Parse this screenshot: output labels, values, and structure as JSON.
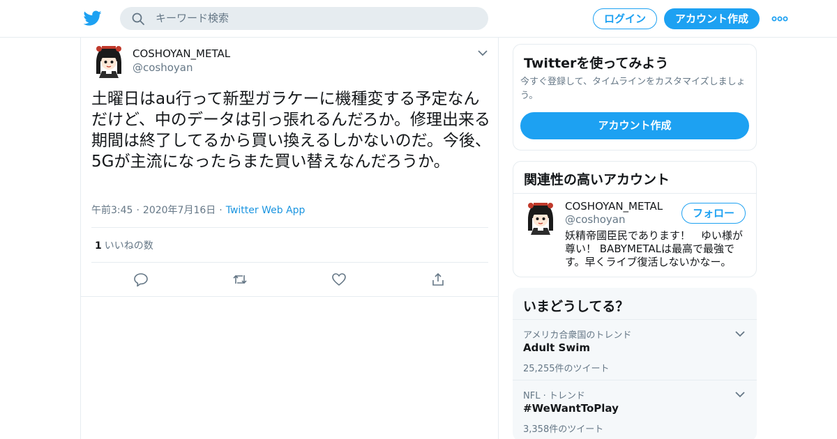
{
  "header": {
    "search_placeholder": "キーワード検索",
    "login_label": "ログイン",
    "signup_label": "アカウント作成"
  },
  "tweet": {
    "author_name": "COSHOYAN_METAL",
    "author_handle": "@coshoyan",
    "text": "土曜日はau行って新型ガラケーに機種変する予定なんだけど、中のデータは引っ張れるんだろか。修理出来る期間は終了してるから買い換えるしかないのだ。今後、5Gが主流になったらまた買い替えなんだろうか。",
    "time": "午前3:45",
    "date": "2020年7月16日",
    "source": "Twitter Web App",
    "like_count": "1",
    "like_label": "いいねの数"
  },
  "sidebar": {
    "signup_card": {
      "title": "Twitterを使ってみよう",
      "description": "今すぐ登録して、タイムラインをカスタマイズしましょう。",
      "button_label": "アカウント作成"
    },
    "related": {
      "title": "関連性の高いアカウント",
      "account_name": "COSHOYAN_METAL",
      "account_handle": "@coshoyan",
      "follow_label": "フォロー",
      "bio": "妖精帝國臣民であります！　ゆい様が尊い！ BABYMETALは最高で最強です。早くライブ復活しないかなー。"
    },
    "trends": {
      "title": "いまどうしてる？",
      "items": [
        {
          "context": "アメリカ合衆国のトレンド",
          "name": "Adult Swim",
          "count": "25,255件のツイート"
        },
        {
          "context": "NFL · トレンド",
          "name": "#WeWantToPlay",
          "count": "3,358件のツイート"
        }
      ]
    }
  },
  "colors": {
    "accent": "#1da1f2",
    "link": "#1b95e0",
    "muted_text": "#657786",
    "border": "#e6ecf0",
    "trend_bg": "#f5f8fa"
  },
  "icons": [
    "twitter-bird-icon",
    "search-icon",
    "more-dots-icon",
    "chevron-down-icon",
    "reply-icon",
    "retweet-icon",
    "like-heart-icon",
    "share-icon"
  ]
}
